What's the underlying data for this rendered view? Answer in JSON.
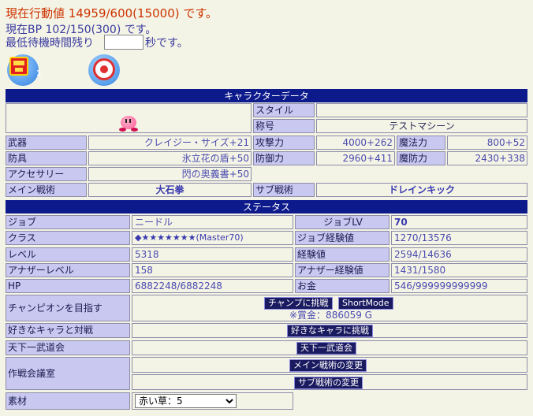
{
  "header": {
    "line1": "現在行動値 14959/600(15000) です。",
    "line2": "現在BP 102/150(300) です。",
    "line3_prefix": "最低待機時間残り",
    "line3_suffix": "秒です。",
    "wait_value": ""
  },
  "icons": {
    "chest_badge": "1",
    "chest_icon": "treasure-chest-icon",
    "heart_icon": "heart-icon"
  },
  "char": {
    "title": "キャラクターデータ",
    "style_label": "スタイル",
    "style_value": "",
    "title_label": "称号",
    "title_value": "テストマシーン",
    "weapon_label": "武器",
    "weapon_value": "クレイジー・サイズ+21",
    "attack_label": "攻撃力",
    "attack_value": "4000+262",
    "magic_label": "魔法力",
    "magic_value": "800+52",
    "armor_label": "防具",
    "armor_value": "氷立花の盾+50",
    "defense_label": "防御力",
    "defense_value": "2960+411",
    "mdef_label": "魔防力",
    "mdef_value": "2430+338",
    "acc_label": "アクセサリー",
    "acc_value": "閃の奥義書+50",
    "main_tech_label": "メイン戦術",
    "main_tech_value": "大石拳",
    "sub_tech_label": "サブ戦術",
    "sub_tech_value": "ドレインキック"
  },
  "status": {
    "title": "ステータス",
    "job_label": "ジョブ",
    "job_value": "ニードル",
    "joblv_label": "ジョブLV",
    "joblv_value": "70",
    "class_label": "クラス",
    "class_value": "◆★★★★★★★(Master70)",
    "jobexp_label": "ジョブ経験値",
    "jobexp_value": "1270/13576",
    "level_label": "レベル",
    "level_value": "5318",
    "exp_label": "経験値",
    "exp_value": "2594/14636",
    "another_label": "アナザーレベル",
    "another_value": "158",
    "anotherexp_label": "アナザー経験値",
    "anotherexp_value": "1431/1580",
    "hp_label": "HP",
    "hp_value": "6882248/6882248",
    "gold_label": "お金",
    "gold_value": "546/999999999999"
  },
  "actions": {
    "champion_label": "チャンピオンを目指す",
    "champion_btn": "チャンプに挑戦",
    "shortmode_btn": "ShortMode",
    "prize": "※賞金：886059 G",
    "fav_label": "好きなキャラと対戦",
    "fav_btn": "好きなキャラに挑戦",
    "tenka_label": "天下一武道会",
    "tenka_btn": "天下一武道会",
    "council_label": "作戦会議室",
    "main_change_btn": "メイン戦術の変更",
    "sub_change_btn": "サブ戦術の変更",
    "material_label": "素材",
    "material_selected": "赤い草：5"
  }
}
